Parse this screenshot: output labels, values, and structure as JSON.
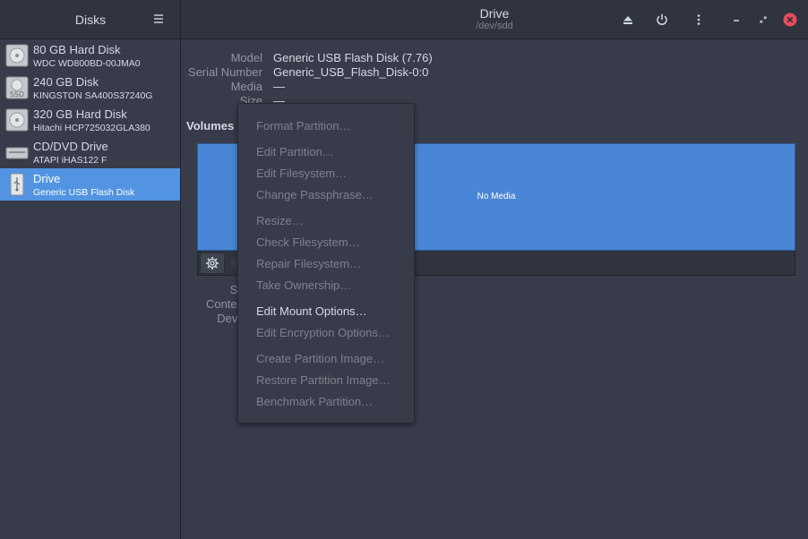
{
  "sidebar_header": {
    "title": "Disks",
    "menu_icon": "hamburger-icon"
  },
  "header": {
    "title": "Drive",
    "subtitle": "/dev/sdd",
    "buttons": [
      "eject-icon",
      "power-icon",
      "more-icon",
      "minimize-icon",
      "restore-icon",
      "close-icon"
    ]
  },
  "disks": [
    {
      "name": "80 GB Hard Disk",
      "sub": "WDC WD800BD-00JMA0",
      "icon": "hdd-icon"
    },
    {
      "name": "240 GB Disk",
      "sub": "KINGSTON SA400S37240G",
      "icon": "ssd-icon",
      "icon_text": "SSD"
    },
    {
      "name": "320 GB Hard Disk",
      "sub": "Hitachi HCP725032GLA380",
      "icon": "hdd-icon"
    },
    {
      "name": "CD/DVD Drive",
      "sub": "ATAPI   iHAS122   F",
      "icon": "optical-drive-icon"
    },
    {
      "name": "Drive",
      "sub": "Generic USB Flash Disk",
      "icon": "usb-drive-icon"
    }
  ],
  "drive_info": {
    "model_label": "Model",
    "model_value": "Generic USB Flash Disk (7.76)",
    "serial_label": "Serial Number",
    "serial_value": "Generic_USB_Flash_Disk-0:0",
    "media_label": "Media",
    "media_value": "—",
    "size_label": "Size",
    "size_value": "—"
  },
  "volumes": {
    "label": "Volumes",
    "no_media": "No Media",
    "detail_size_label": "Size",
    "detail_contents_label": "Contents",
    "detail_device_label": "Device"
  },
  "menu": {
    "items": [
      {
        "label": "Format Partition…",
        "enabled": false
      },
      {
        "label": "Edit Partition…",
        "enabled": false
      },
      {
        "label": "Edit Filesystem…",
        "enabled": false
      },
      {
        "label": "Change Passphrase…",
        "enabled": false
      },
      {
        "label": "Resize…",
        "enabled": false
      },
      {
        "label": "Check Filesystem…",
        "enabled": false
      },
      {
        "label": "Repair Filesystem…",
        "enabled": false
      },
      {
        "label": "Take Ownership…",
        "enabled": false
      },
      {
        "label": "Edit Mount Options…",
        "enabled": true
      },
      {
        "label": "Edit Encryption Options…",
        "enabled": false
      },
      {
        "label": "Create Partition Image…",
        "enabled": false
      },
      {
        "label": "Restore Partition Image…",
        "enabled": false
      },
      {
        "label": "Benchmark Partition…",
        "enabled": false
      }
    ]
  },
  "colors": {
    "accent": "#5294e2",
    "volume_bar": "#4a86d6",
    "close_button": "#e74c5a"
  }
}
